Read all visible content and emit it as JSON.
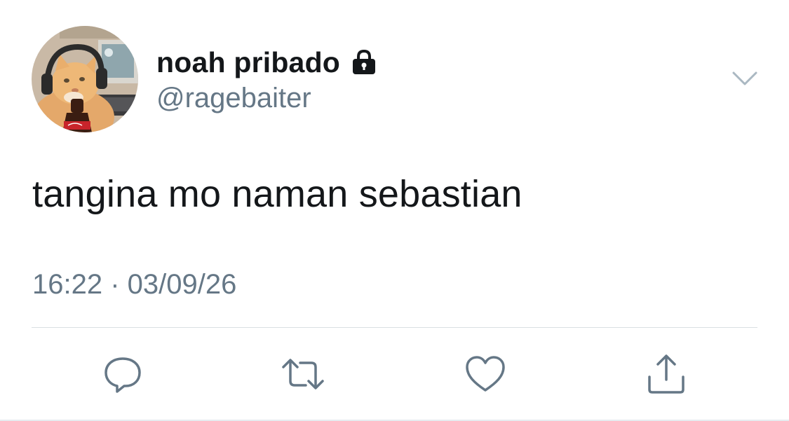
{
  "tweet": {
    "display_name": "noah pribado",
    "handle": "@ragebaiter",
    "protected_icon": "lock-icon",
    "text": "tangina mo naman sebastian",
    "timestamp": "16:22 · 03/09/26"
  },
  "avatar": {
    "description_icon": "avatar"
  },
  "actions": [
    {
      "name": "reply",
      "icon": "comment-icon"
    },
    {
      "name": "retweet",
      "icon": "retweet-icon"
    },
    {
      "name": "like",
      "icon": "heart-icon"
    },
    {
      "name": "share",
      "icon": "share-icon"
    }
  ],
  "colors": {
    "text_primary": "#14171a",
    "text_secondary": "#657786",
    "icon_gray": "#657786",
    "divider": "#dadfe3"
  }
}
